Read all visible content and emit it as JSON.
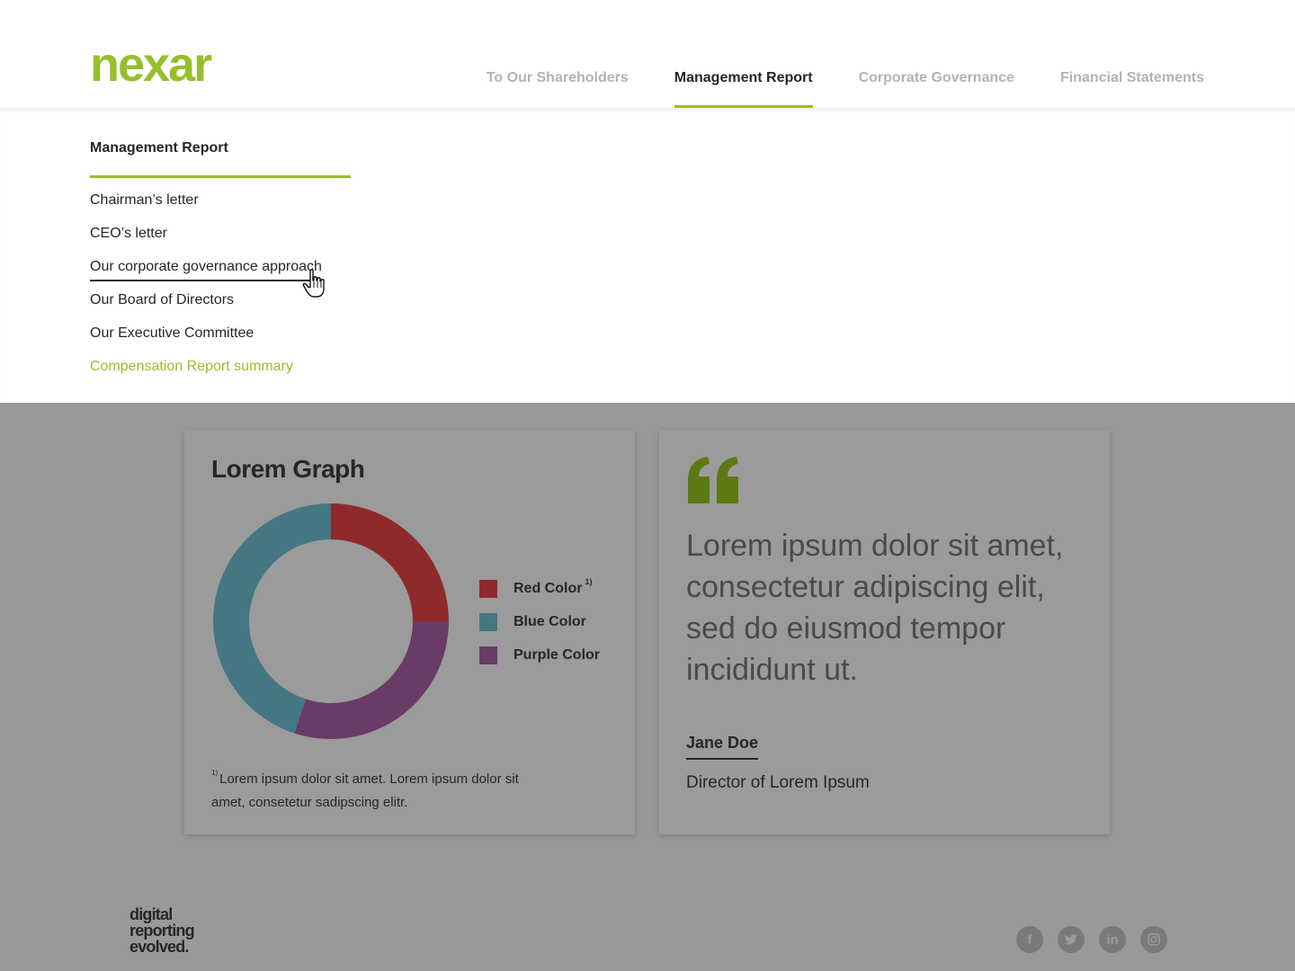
{
  "brand": {
    "logo_text": "nexar",
    "accent": "#97bf2b"
  },
  "nav": {
    "items": [
      {
        "label": "To Our Shareholders",
        "active": false
      },
      {
        "label": "Management Report",
        "active": true
      },
      {
        "label": "Corporate Governance",
        "active": false
      },
      {
        "label": "Financial Statements",
        "active": false
      }
    ]
  },
  "dropdown": {
    "title": "Management Report",
    "items": [
      {
        "label": "Chairman’s letter"
      },
      {
        "label": "CEO’s letter"
      },
      {
        "label": "Our corporate governance approach",
        "state": "hover"
      },
      {
        "label": "Our Board of Directors"
      },
      {
        "label": "Our Executive Committee"
      },
      {
        "label": "Compensation Report summary",
        "state": "current"
      }
    ]
  },
  "graph_card": {
    "title": "Lorem Graph",
    "legend_note_marker": "1)",
    "footnote_marker": "1)",
    "footnote": "Lorem ipsum dolor sit amet. Lorem ipsum dolor sit amet, consetetur sadipscing elitr."
  },
  "chart_data": {
    "type": "pie",
    "title": "Lorem Graph",
    "series": [
      {
        "name": "Red Color",
        "value": 25,
        "color": "#8e2a2b"
      },
      {
        "name": "Purple Color",
        "value": 30,
        "color": "#6a3b66"
      },
      {
        "name": "Blue Color",
        "value": 45,
        "color": "#457783"
      }
    ],
    "legend": [
      "Red Color",
      "Blue Color",
      "Purple Color"
    ],
    "legend_position": "right"
  },
  "quote_card": {
    "quote_icon": "quote-icon",
    "text": "Lorem ipsum dolor sit amet, consectetur adipiscing elit, sed do eiusmod tempor incididunt ut.",
    "name": "Jane Doe",
    "role": "Director of Lorem Ipsum"
  },
  "footer": {
    "tagline": [
      "digital",
      "reporting",
      "evolved."
    ],
    "socials": [
      {
        "icon": "facebook-icon",
        "glyph": "f"
      },
      {
        "icon": "twitter-icon",
        "glyph": "t"
      },
      {
        "icon": "linkedin-icon",
        "glyph": "in"
      },
      {
        "icon": "instagram-icon",
        "glyph": ""
      }
    ]
  }
}
